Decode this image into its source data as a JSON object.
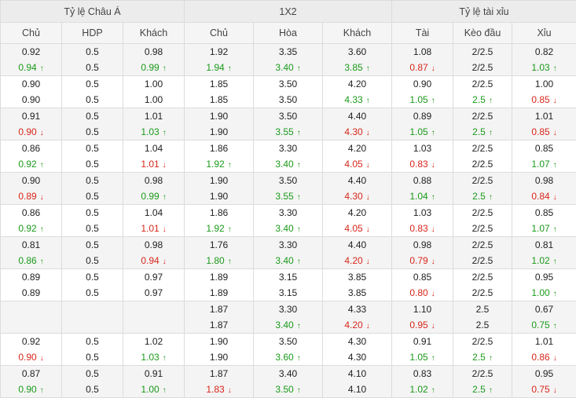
{
  "groups": [
    {
      "label": "Tỷ lệ Châu Á",
      "span": 3
    },
    {
      "label": "1X2",
      "span": 3
    },
    {
      "label": "Tỷ lệ tài xỉu",
      "span": 3
    }
  ],
  "columns": [
    "Chủ",
    "HDP",
    "Khách",
    "Chủ",
    "Hòa",
    "Khách",
    "Tài",
    "Kèo đầu",
    "Xỉu"
  ],
  "rows": [
    [
      [
        "0.92",
        "n",
        "0.94",
        "g"
      ],
      [
        "0.5",
        "n",
        "0.5",
        "n"
      ],
      [
        "0.98",
        "n",
        "0.99",
        "g"
      ],
      [
        "1.92",
        "n",
        "1.94",
        "g"
      ],
      [
        "3.35",
        "n",
        "3.40",
        "g"
      ],
      [
        "3.60",
        "n",
        "3.85",
        "g"
      ],
      [
        "1.08",
        "n",
        "0.87",
        "r"
      ],
      [
        "2/2.5",
        "n",
        "2/2.5",
        "n"
      ],
      [
        "0.82",
        "n",
        "1.03",
        "g"
      ]
    ],
    [
      [
        "0.90",
        "n",
        "0.90",
        "n"
      ],
      [
        "0.5",
        "n",
        "0.5",
        "n"
      ],
      [
        "1.00",
        "n",
        "1.00",
        "n"
      ],
      [
        "1.85",
        "n",
        "1.85",
        "n"
      ],
      [
        "3.50",
        "n",
        "3.50",
        "n"
      ],
      [
        "4.20",
        "n",
        "4.33",
        "g"
      ],
      [
        "0.90",
        "n",
        "1.05",
        "g"
      ],
      [
        "2/2.5",
        "n",
        "2.5",
        "g"
      ],
      [
        "1.00",
        "n",
        "0.85",
        "r"
      ]
    ],
    [
      [
        "0.91",
        "n",
        "0.90",
        "r"
      ],
      [
        "0.5",
        "n",
        "0.5",
        "n"
      ],
      [
        "1.01",
        "n",
        "1.03",
        "g"
      ],
      [
        "1.90",
        "n",
        "1.90",
        "n"
      ],
      [
        "3.50",
        "n",
        "3.55",
        "g"
      ],
      [
        "4.40",
        "n",
        "4.30",
        "r"
      ],
      [
        "0.89",
        "n",
        "1.05",
        "g"
      ],
      [
        "2/2.5",
        "n",
        "2.5",
        "g"
      ],
      [
        "1.01",
        "n",
        "0.85",
        "r"
      ]
    ],
    [
      [
        "0.86",
        "n",
        "0.92",
        "g"
      ],
      [
        "0.5",
        "n",
        "0.5",
        "n"
      ],
      [
        "1.04",
        "n",
        "1.01",
        "r"
      ],
      [
        "1.86",
        "n",
        "1.92",
        "g"
      ],
      [
        "3.30",
        "n",
        "3.40",
        "g"
      ],
      [
        "4.20",
        "n",
        "4.05",
        "r"
      ],
      [
        "1.03",
        "n",
        "0.83",
        "r"
      ],
      [
        "2/2.5",
        "n",
        "2/2.5",
        "n"
      ],
      [
        "0.85",
        "n",
        "1.07",
        "g"
      ]
    ],
    [
      [
        "0.90",
        "n",
        "0.89",
        "r"
      ],
      [
        "0.5",
        "n",
        "0.5",
        "n"
      ],
      [
        "0.98",
        "n",
        "0.99",
        "g"
      ],
      [
        "1.90",
        "n",
        "1.90",
        "n"
      ],
      [
        "3.50",
        "n",
        "3.55",
        "g"
      ],
      [
        "4.40",
        "n",
        "4.30",
        "r"
      ],
      [
        "0.88",
        "n",
        "1.04",
        "g"
      ],
      [
        "2/2.5",
        "n",
        "2.5",
        "g"
      ],
      [
        "0.98",
        "n",
        "0.84",
        "r"
      ]
    ],
    [
      [
        "0.86",
        "n",
        "0.92",
        "g"
      ],
      [
        "0.5",
        "n",
        "0.5",
        "n"
      ],
      [
        "1.04",
        "n",
        "1.01",
        "r"
      ],
      [
        "1.86",
        "n",
        "1.92",
        "g"
      ],
      [
        "3.30",
        "n",
        "3.40",
        "g"
      ],
      [
        "4.20",
        "n",
        "4.05",
        "r"
      ],
      [
        "1.03",
        "n",
        "0.83",
        "r"
      ],
      [
        "2/2.5",
        "n",
        "2/2.5",
        "n"
      ],
      [
        "0.85",
        "n",
        "1.07",
        "g"
      ]
    ],
    [
      [
        "0.81",
        "n",
        "0.86",
        "g"
      ],
      [
        "0.5",
        "n",
        "0.5",
        "n"
      ],
      [
        "0.98",
        "n",
        "0.94",
        "r"
      ],
      [
        "1.76",
        "n",
        "1.80",
        "g"
      ],
      [
        "3.30",
        "n",
        "3.40",
        "g"
      ],
      [
        "4.40",
        "n",
        "4.20",
        "r"
      ],
      [
        "0.98",
        "n",
        "0.79",
        "r"
      ],
      [
        "2/2.5",
        "n",
        "2/2.5",
        "n"
      ],
      [
        "0.81",
        "n",
        "1.02",
        "g"
      ]
    ],
    [
      [
        "0.89",
        "n",
        "0.89",
        "n"
      ],
      [
        "0.5",
        "n",
        "0.5",
        "n"
      ],
      [
        "0.97",
        "n",
        "0.97",
        "n"
      ],
      [
        "1.89",
        "n",
        "1.89",
        "n"
      ],
      [
        "3.15",
        "n",
        "3.15",
        "n"
      ],
      [
        "3.85",
        "n",
        "3.85",
        "n"
      ],
      [
        "0.85",
        "n",
        "0.80",
        "r"
      ],
      [
        "2/2.5",
        "n",
        "2/2.5",
        "n"
      ],
      [
        "0.95",
        "n",
        "1.00",
        "g"
      ]
    ],
    [
      [
        "",
        "n",
        "",
        "n"
      ],
      [
        "",
        "n",
        "",
        "n"
      ],
      [
        "",
        "n",
        "",
        "n"
      ],
      [
        "1.87",
        "n",
        "1.87",
        "n"
      ],
      [
        "3.30",
        "n",
        "3.40",
        "g"
      ],
      [
        "4.33",
        "n",
        "4.20",
        "r"
      ],
      [
        "1.10",
        "n",
        "0.95",
        "r"
      ],
      [
        "2.5",
        "n",
        "2.5",
        "n"
      ],
      [
        "0.67",
        "n",
        "0.75",
        "g"
      ]
    ],
    [
      [
        "0.92",
        "n",
        "0.90",
        "r"
      ],
      [
        "0.5",
        "n",
        "0.5",
        "n"
      ],
      [
        "1.02",
        "n",
        "1.03",
        "g"
      ],
      [
        "1.90",
        "n",
        "1.90",
        "n"
      ],
      [
        "3.50",
        "n",
        "3.60",
        "g"
      ],
      [
        "4.30",
        "n",
        "4.30",
        "n"
      ],
      [
        "0.91",
        "n",
        "1.05",
        "g"
      ],
      [
        "2/2.5",
        "n",
        "2.5",
        "g"
      ],
      [
        "1.01",
        "n",
        "0.86",
        "r"
      ]
    ],
    [
      [
        "0.87",
        "n",
        "0.90",
        "g"
      ],
      [
        "0.5",
        "n",
        "0.5",
        "n"
      ],
      [
        "0.91",
        "n",
        "1.00",
        "g"
      ],
      [
        "1.87",
        "n",
        "1.83",
        "r"
      ],
      [
        "3.40",
        "n",
        "3.50",
        "g"
      ],
      [
        "4.10",
        "n",
        "4.10",
        "n"
      ],
      [
        "0.83",
        "n",
        "1.02",
        "g"
      ],
      [
        "2/2.5",
        "n",
        "2.5",
        "g"
      ],
      [
        "0.95",
        "n",
        "0.75",
        "r"
      ]
    ]
  ],
  "colors": {
    "up": "#1a9a1a",
    "down": "#d8261b",
    "neutral": "#222222"
  },
  "icons": {
    "up": "arrow-up-icon",
    "down": "arrow-down-icon"
  }
}
